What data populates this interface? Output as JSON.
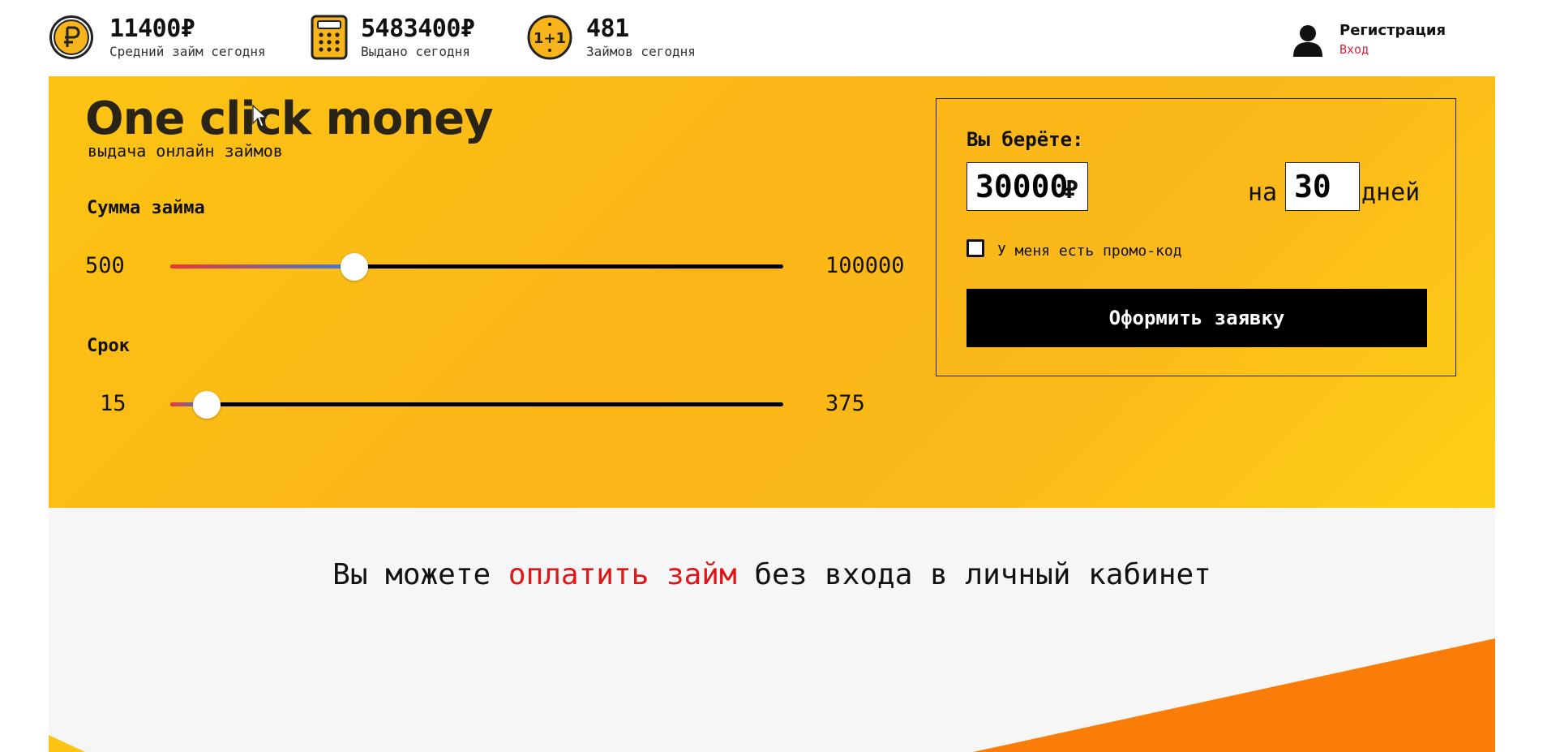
{
  "stats": [
    {
      "value": "11400₽",
      "label": "Средний займ сегодня",
      "icon": "ruble-coin-icon"
    },
    {
      "value": "5483400₽",
      "label": "Выдано сегодня",
      "icon": "calculator-icon"
    },
    {
      "value": "481",
      "label": "Займов сегодня",
      "icon": "one-plus-one-coin-icon"
    }
  ],
  "account": {
    "register": "Регистрация",
    "login": "Вход"
  },
  "hero": {
    "title": "One click money",
    "tagline": "выдача онлайн займов",
    "amount": {
      "label": "Сумма займа",
      "min": "500",
      "max": "100000",
      "fraction": 0.3
    },
    "term": {
      "label": "Срок",
      "min": "15",
      "max": "375",
      "fraction": 0.06
    }
  },
  "order": {
    "take_label": "Вы берёте:",
    "amount_value": "30000",
    "currency": "₽",
    "on_label": "на",
    "days_value": "30",
    "days_label": "дней",
    "promo_label": "У меня есть промо-код",
    "submit_label": "Оформить заявку"
  },
  "pay": {
    "before": "Вы можете ",
    "link": "оплатить займ",
    "after": " без входа в личный кабинет"
  },
  "colors": {
    "accent": "#fcc414",
    "danger": "#e01515",
    "orange": "#fa7d09"
  }
}
